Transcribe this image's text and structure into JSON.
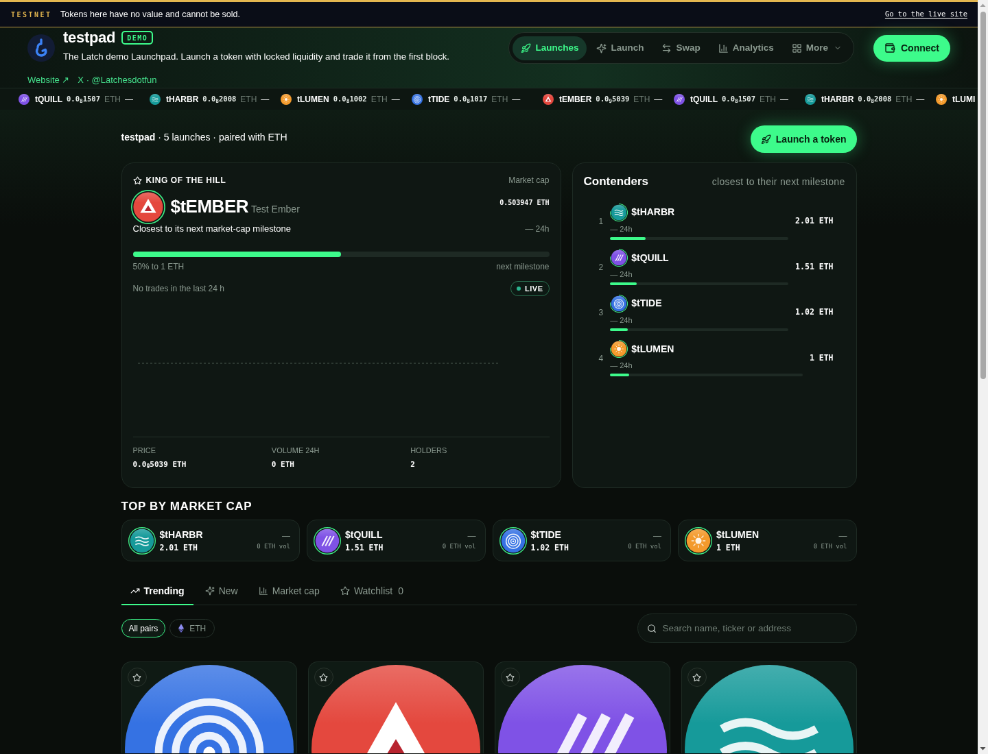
{
  "banner": {
    "label": "TESTNET",
    "message": "Tokens here have no value and cannot be sold.",
    "link": "Go to the live site"
  },
  "header": {
    "title": "testpad",
    "badge": "DEMO",
    "description": "The Latch demo Launchpad. Launch a token with locked liquidity and trade it from the first block.",
    "links": [
      "Website ↗",
      "X · @Latchesdotfun"
    ]
  },
  "nav": [
    {
      "label": "Launches",
      "selected": true,
      "has_menu": false
    },
    {
      "label": "Launch",
      "selected": false,
      "has_menu": false
    },
    {
      "label": "Swap",
      "selected": false,
      "has_menu": false
    },
    {
      "label": "Analytics",
      "selected": false,
      "has_menu": false
    },
    {
      "label": "More",
      "selected": false,
      "has_menu": true
    }
  ],
  "connect_button": "Connect",
  "ticker": [
    {
      "ticker": "tQUILL",
      "price": "0.0$_{8}$1507",
      "unit": "ETH",
      "change": "—",
      "kind": "stripes",
      "color": "#7f52e6"
    },
    {
      "ticker": "tHARBR",
      "price": "0.0$_{8}$2008",
      "unit": "ETH",
      "change": "—",
      "kind": "waves",
      "color": "#169a9a"
    },
    {
      "ticker": "tLUMEN",
      "price": "0.0$_{8}$1002",
      "unit": "ETH",
      "change": "—",
      "kind": "sun",
      "color": "#f39a2c"
    },
    {
      "ticker": "tTIDE",
      "price": "0.0$_{8}$1017",
      "unit": "ETH",
      "change": "—",
      "kind": "rings",
      "color": "#3572e3"
    },
    {
      "ticker": "tEMBER",
      "price": "0.0$_{9}$5039",
      "unit": "ETH",
      "change": "—",
      "kind": "triangle",
      "color": "#e4483e"
    },
    {
      "ticker": "tQUILL",
      "price": "0.0$_{8}$1507",
      "unit": "ETH",
      "change": "—",
      "kind": "stripes",
      "color": "#7f52e6"
    },
    {
      "ticker": "tHARBR",
      "price": "0.0$_{8}$2008",
      "unit": "ETH",
      "change": "—",
      "kind": "waves",
      "color": "#169a9a"
    },
    {
      "ticker": "tLUMI",
      "kind": "sun",
      "color": "#f39a2c"
    }
  ],
  "summary": "**testpad** · 5 launches · paired with ETH",
  "launch_button": "Launch a token",
  "king": {
    "heading": "KING OF THE HILL",
    "market_cap_label": "Market cap",
    "ticker": "$tEMBER",
    "name": "Test Ember",
    "market_cap": "0.503947 ETH",
    "tagline": "Closest to its next market-cap milestone",
    "change": "— 24h",
    "level": 0.5,
    "progress_label": "50% to 1 ETH",
    "milestone_label": "next milestone",
    "trades_note": "No trades in the last 24 h",
    "status": "LIVE",
    "kind": "triangle",
    "color": "#e4483e",
    "stats": [
      {
        "label": "PRICE",
        "value": "0.0$_{9}$5039 ETH"
      },
      {
        "label": "VOLUME 24H",
        "value": "0 ETH"
      },
      {
        "label": "HOLDERS",
        "value": "2"
      }
    ]
  },
  "contenders": {
    "title": "Contenders",
    "subtitle": "closest to their next milestone",
    "items": [
      {
        "rank": "1",
        "ticker": "$tHARBR",
        "change": "— 24h",
        "level": 0.2,
        "market_cap": "2.01 ETH",
        "kind": "waves",
        "color": "#169a9a"
      },
      {
        "rank": "2",
        "ticker": "$tQUILL",
        "change": "— 24h",
        "level": 0.15,
        "market_cap": "1.51 ETH",
        "kind": "stripes",
        "color": "#7f52e6"
      },
      {
        "rank": "3",
        "ticker": "$tTIDE",
        "change": "— 24h",
        "level": 0.1,
        "market_cap": "1.02 ETH",
        "kind": "rings",
        "color": "#3572e3"
      },
      {
        "rank": "4",
        "ticker": "$tLUMEN",
        "change": "— 24h",
        "level": 0.1,
        "market_cap": "1 ETH",
        "kind": "sun",
        "color": "#f39a2c"
      }
    ]
  },
  "top_by_market_cap": {
    "title": "TOP BY MARKET CAP",
    "items": [
      {
        "ticker": "$tHARBR",
        "market_cap": "2.01 ETH",
        "change": "—",
        "volume": "0 ETH vol",
        "kind": "waves",
        "color": "#169a9a"
      },
      {
        "ticker": "$tQUILL",
        "market_cap": "1.51 ETH",
        "change": "—",
        "volume": "0 ETH vol",
        "kind": "stripes",
        "color": "#7f52e6"
      },
      {
        "ticker": "$tTIDE",
        "market_cap": "1.02 ETH",
        "change": "—",
        "volume": "0 ETH vol",
        "kind": "rings",
        "color": "#3572e3"
      },
      {
        "ticker": "$tLUMEN",
        "market_cap": "1 ETH",
        "change": "—",
        "volume": "0 ETH vol",
        "kind": "sun",
        "color": "#f39a2c"
      }
    ]
  },
  "tabs": [
    {
      "label": "Trending",
      "selected": true
    },
    {
      "label": "New",
      "selected": false
    },
    {
      "label": "Market cap",
      "selected": false
    },
    {
      "label": "Watchlist",
      "count": "0",
      "selected": false
    }
  ],
  "filters": [
    {
      "label": "All pairs",
      "kind": "label",
      "selected": true
    },
    {
      "label": "ETH",
      "kind": "asset",
      "selected": false
    }
  ],
  "search": {
    "placeholder": "Search name, ticker or address"
  },
  "launch_cards": [
    {
      "kind": "rings",
      "color": "#3572e3",
      "starred": false
    },
    {
      "kind": "triangle",
      "color": "#e4483e",
      "starred": false
    },
    {
      "kind": "stripes",
      "color": "#7f52e6",
      "starred": false
    },
    {
      "kind": "waves",
      "color": "#169a9a",
      "starred": false
    }
  ]
}
